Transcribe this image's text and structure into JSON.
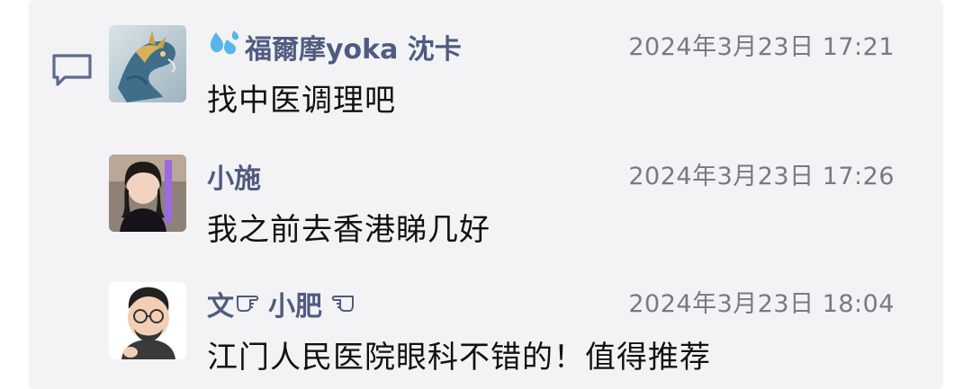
{
  "comments": [
    {
      "name_prefix_icon": "water-droplets-icon",
      "name": "福爾摩yoka 沈卡",
      "time": "2024年3月23日 17:21",
      "text": "找中医调理吧",
      "avatar": "dragon-avatar"
    },
    {
      "name": "小施",
      "time": "2024年3月23日 17:26",
      "text": "我之前去香港睇几好",
      "avatar": "woman-avatar"
    },
    {
      "name_part1": "文",
      "name_icon1": "pointing-hand-icon",
      "name_part2": "小肥",
      "name_icon2": "pointing-hand-icon",
      "time": "2024年3月23日 18:04",
      "text": "江门人民医院眼科不错的！值得推荐",
      "avatar": "cartoon-man-avatar"
    }
  ],
  "colors": {
    "panel_bg": "#f3f3f5",
    "name": "#4f5b80",
    "time": "#777a80",
    "text": "#111111"
  },
  "icons": {
    "comment": "speech-bubble-icon"
  }
}
